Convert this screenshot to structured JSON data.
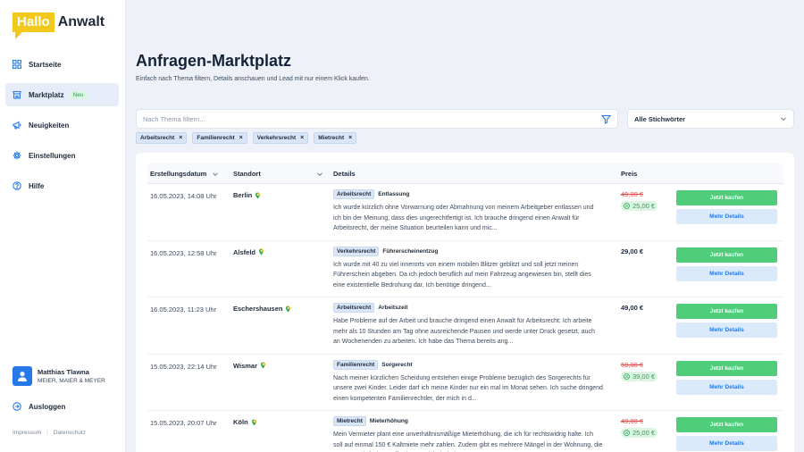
{
  "brand": {
    "logo_box": "Hallo",
    "logo_text": "Anwalt",
    "accent": "#f2c81c"
  },
  "nav": {
    "items": [
      {
        "label": "Startseite",
        "icon": "grid-icon"
      },
      {
        "label": "Marktplatz",
        "icon": "store-icon",
        "badge": "Neu"
      },
      {
        "label": "Neuigkeiten",
        "icon": "megaphone-icon"
      },
      {
        "label": "Einstellungen",
        "icon": "gear-icon"
      },
      {
        "label": "Hilfe",
        "icon": "help-icon"
      }
    ]
  },
  "user": {
    "name": "Matthias Tlawna",
    "company": "MEIER, MAIER & MEYER"
  },
  "logout_label": "Ausloggen",
  "footer": {
    "impressum": "Impressum",
    "datenschutz": "Datenschutz"
  },
  "page": {
    "title": "Anfragen-Marktplatz",
    "subtitle": "Einfach nach Thema filtern, Details anschauen und Lead mit nur einem Klick kaufen."
  },
  "search": {
    "placeholder": "Nach Thema filtern...",
    "value": ""
  },
  "keyword_select": {
    "selected": "Alle Stichwörter"
  },
  "chips": [
    "Arbeitsrecht",
    "Familienrecht",
    "Verkehrsrecht",
    "Mietrecht"
  ],
  "table": {
    "headers": {
      "date": "Erstellungsdatum",
      "location": "Standort",
      "details": "Details",
      "price": "Preis"
    },
    "buy_label": "Jetzt kaufen",
    "more_label": "Mehr Details",
    "rows": [
      {
        "date": "16.05.2023, 14:08 Uhr",
        "location": "Berlin",
        "tag": "Arbeitsrecht",
        "subtag": "Entlassung",
        "desc": "Ich wurde kürzlich ohne Vorwarnung oder Abmahnung von meinem Arbeitgeber entlassen und ich bin der Meinung, dass dies ungerechtfertigt ist. Ich brauche dringend einen Anwalt für Arbeitsrecht, der meine Situation beurteilen kann und mic...",
        "price_old": "49,00 €",
        "price": "25,00 €",
        "discount": true
      },
      {
        "date": "16.05.2023, 12:58 Uhr",
        "location": "Alsfeld",
        "tag": "Verkehrsrecht",
        "subtag": "Führerscheinentzug",
        "desc": "Ich wurde mit 40 zu viel innerorts von einem mobilen Blitzer geblitzt und soll jetzt meinen Führerschein abgeben. Da ich jedoch beruflich auf mein Fahrzeug angewiesen bin, stellt dies eine existentielle Bedrohung dar. Ich benötige dringend...",
        "price_old": "",
        "price": "29,00 €",
        "discount": false
      },
      {
        "date": "16.05.2023, 11:23 Uhr",
        "location": "Eschershausen",
        "tag": "Arbeitsrecht",
        "subtag": "Arbeitszeit",
        "desc": "Habe Probleme auf der Arbeit und brauche dringend einen Anwalt für Arbeitsrecht: Ich arbeite mehr als 10 Stunden am Tag ohne ausreichende Pausen und werde unter Druck gesetzt, auch an Wochenenden zu arbeiten. Ich habe das Thema bereits ang...",
        "price_old": "",
        "price": "49,00 €",
        "discount": false
      },
      {
        "date": "15.05.2023, 22:14 Uhr",
        "location": "Wismar",
        "tag": "Familienrecht",
        "subtag": "Sorgerecht",
        "desc": "Nach meiner kürzlichen Scheidung entstehen einige Probleme bezüglich des Sorgerechts für unsere zwei Kinder. Leider darf ich meine Kinder nur ein mal im Monat sehen. Ich suche dringend einen kompetenten Familienrechtler, der mich in d...",
        "price_old": "59,00 €",
        "price": "39,00 €",
        "discount": true
      },
      {
        "date": "15.05.2023, 20:07 Uhr",
        "location": "Köln",
        "tag": "Mietrecht",
        "subtag": "Mieterhöhung",
        "desc": "Mein Vermieter plant eine unverhältnismäßige Mieterhöhung, die ich für rechtswidrig halte. Ich soll auf einmal 150 € Kaltmiete mehr zahlen. Zudem gibt es mehrere Mängel in der Wohnung, die er trotz mehrfacher Aufforderung nicht behebt...",
        "price_old": "49,00 €",
        "price": "25,00 €",
        "discount": true
      }
    ]
  },
  "colors": {
    "buy": "#4fcd7a",
    "more_bg": "#dbeafb",
    "more_text": "#2478e8",
    "old_price": "#e04a4a",
    "discount_green": "#2f9e55",
    "chip_bg": "#d9e6f7"
  }
}
